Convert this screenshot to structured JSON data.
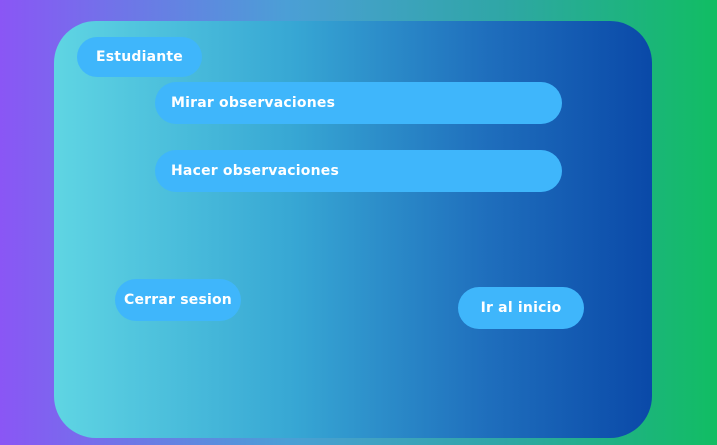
{
  "header": {
    "role_label": "Estudiante"
  },
  "menu": {
    "items": [
      {
        "label": "Mirar observaciones"
      },
      {
        "label": "Hacer observaciones"
      }
    ]
  },
  "actions": {
    "logout_label": "Cerrar sesion",
    "home_label": "Ir al inicio"
  },
  "colors": {
    "button_background": "#3fb6fb",
    "button_text": "#ffffff",
    "page_gradient_start": "#8a56f5",
    "page_gradient_end": "#11bd63",
    "card_gradient_start": "#5fd5e3",
    "card_gradient_end": "#0a49a8"
  }
}
